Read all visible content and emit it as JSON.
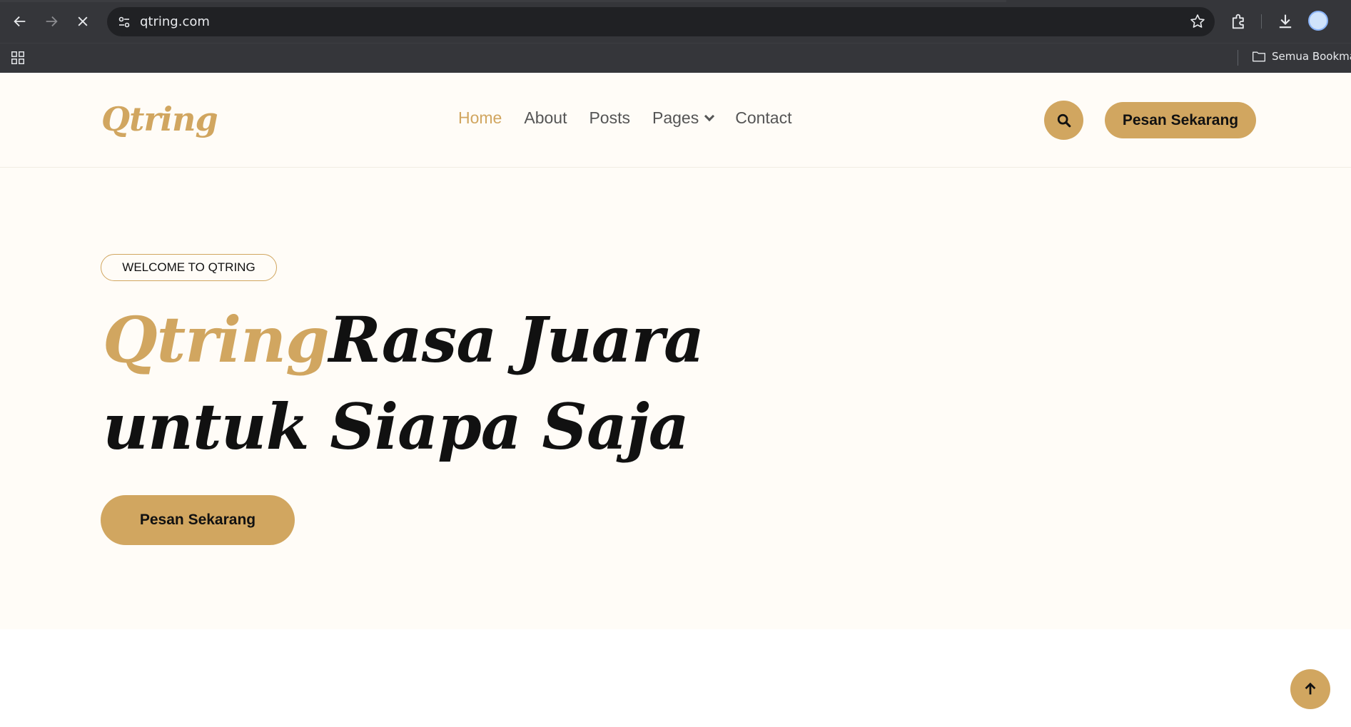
{
  "browser": {
    "url": "qtring.com",
    "bookmarks_folder": "Semua Bookmark"
  },
  "header": {
    "logo": "Qtring",
    "nav": [
      {
        "label": "Home",
        "active": true
      },
      {
        "label": "About"
      },
      {
        "label": "Posts"
      },
      {
        "label": "Pages",
        "dropdown": true
      },
      {
        "label": "Contact"
      }
    ],
    "cta": "Pesan Sekarang"
  },
  "hero": {
    "tagline": "WELCOME TO QTRING",
    "title_brand": "Qtring",
    "title_rest": "Rasa Juara untuk Siapa Saja",
    "cta": "Pesan Sekarang"
  },
  "colors": {
    "accent": "#d1a660",
    "background": "#fffcf7",
    "chrome": "#35363a"
  },
  "icons": [
    "back-arrow-icon",
    "forward-arrow-icon",
    "stop-loading-icon",
    "site-settings-icon",
    "bookmark-star-icon",
    "extensions-icon",
    "download-icon",
    "profile-avatar-icon",
    "apps-grid-icon",
    "folder-icon",
    "search-icon",
    "arrow-up-icon"
  ]
}
